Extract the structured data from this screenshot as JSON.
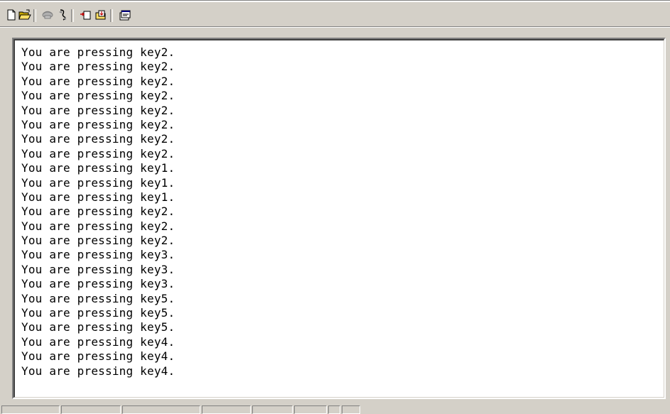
{
  "toolbar": {
    "buttons": [
      {
        "name": "new-document-icon"
      },
      {
        "name": "open-folder-icon"
      },
      {
        "name": "connect-phone-icon"
      },
      {
        "name": "disconnect-icon"
      },
      {
        "name": "send-icon"
      },
      {
        "name": "receive-icon"
      },
      {
        "name": "properties-icon"
      }
    ]
  },
  "terminal": {
    "lines": [
      "You are pressing key2.",
      "You are pressing key2.",
      "You are pressing key2.",
      "You are pressing key2.",
      "You are pressing key2.",
      "You are pressing key2.",
      "You are pressing key2.",
      "You are pressing key2.",
      "You are pressing key1.",
      "You are pressing key1.",
      "You are pressing key1.",
      "You are pressing key2.",
      "You are pressing key2.",
      "You are pressing key2.",
      "You are pressing key3.",
      "You are pressing key3.",
      "You are pressing key3.",
      "You are pressing key5.",
      "You are pressing key5.",
      "You are pressing key5.",
      "You are pressing key4.",
      "You are pressing key4.",
      "You are pressing key4."
    ]
  },
  "statusbar": {
    "cells": [
      "",
      "",
      "",
      "",
      "",
      "",
      "",
      ""
    ]
  },
  "colors": {
    "chrome": "#d4d0c8",
    "terminal_bg": "#ffffff",
    "terminal_text": "#000000"
  }
}
